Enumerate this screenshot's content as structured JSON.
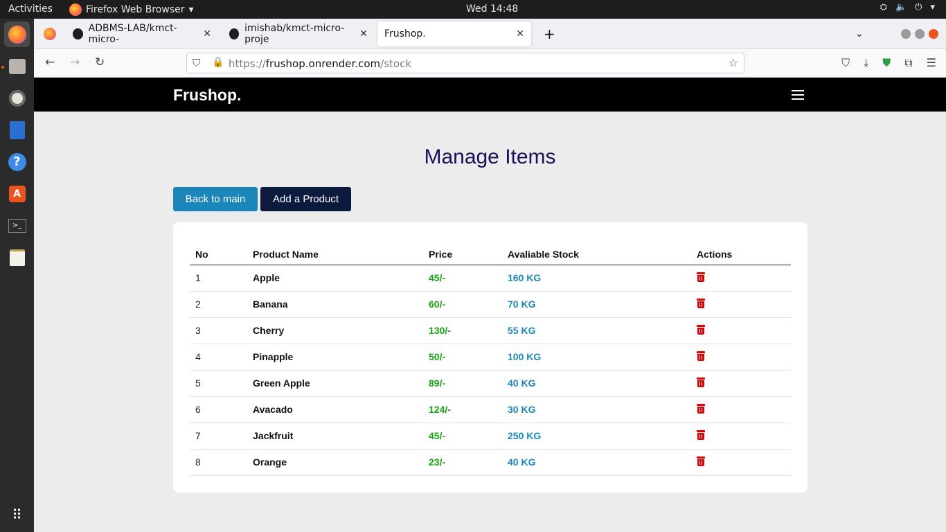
{
  "os": {
    "activities_label": "Activities",
    "app_menu_label": "Firefox Web Browser",
    "clock": "Wed 14:48"
  },
  "browser": {
    "tabs": [
      {
        "label": "ADBMS-LAB/kmct-micro-",
        "icon": "github-icon"
      },
      {
        "label": "imishab/kmct-micro-proje",
        "icon": "github-icon"
      },
      {
        "label": "Frushop.",
        "icon": "none",
        "active": true
      }
    ],
    "url": {
      "prefix": "https://",
      "host": "frushop.onrender.com",
      "path": "/stock"
    }
  },
  "site": {
    "brand": "Frushop.",
    "page_title": "Manage Items",
    "back_button": "Back to main",
    "add_button": "Add a Product",
    "table": {
      "headers": [
        "No",
        "Product Name",
        "Price",
        "Avaliable Stock",
        "Actions"
      ],
      "rows": [
        {
          "no": "1",
          "name": "Apple",
          "price": "45/-",
          "stock": "160 KG"
        },
        {
          "no": "2",
          "name": "Banana",
          "price": "60/-",
          "stock": "70 KG"
        },
        {
          "no": "3",
          "name": "Cherry",
          "price": "130/-",
          "stock": "55 KG"
        },
        {
          "no": "4",
          "name": "Pinapple",
          "price": "50/-",
          "stock": "100 KG"
        },
        {
          "no": "5",
          "name": "Green Apple",
          "price": "89/-",
          "stock": "40 KG"
        },
        {
          "no": "6",
          "name": "Avacado",
          "price": "124/-",
          "stock": "30 KG"
        },
        {
          "no": "7",
          "name": "Jackfruit",
          "price": "45/-",
          "stock": "250 KG"
        },
        {
          "no": "8",
          "name": "Orange",
          "price": "23/-",
          "stock": "40 KG"
        }
      ]
    }
  },
  "colors": {
    "price": "#18a310",
    "stock": "#1b86b9",
    "delete": "#e20000",
    "title": "#1e0e5a",
    "back_button": "#1b86b9",
    "add_button": "#0b1a3d"
  }
}
